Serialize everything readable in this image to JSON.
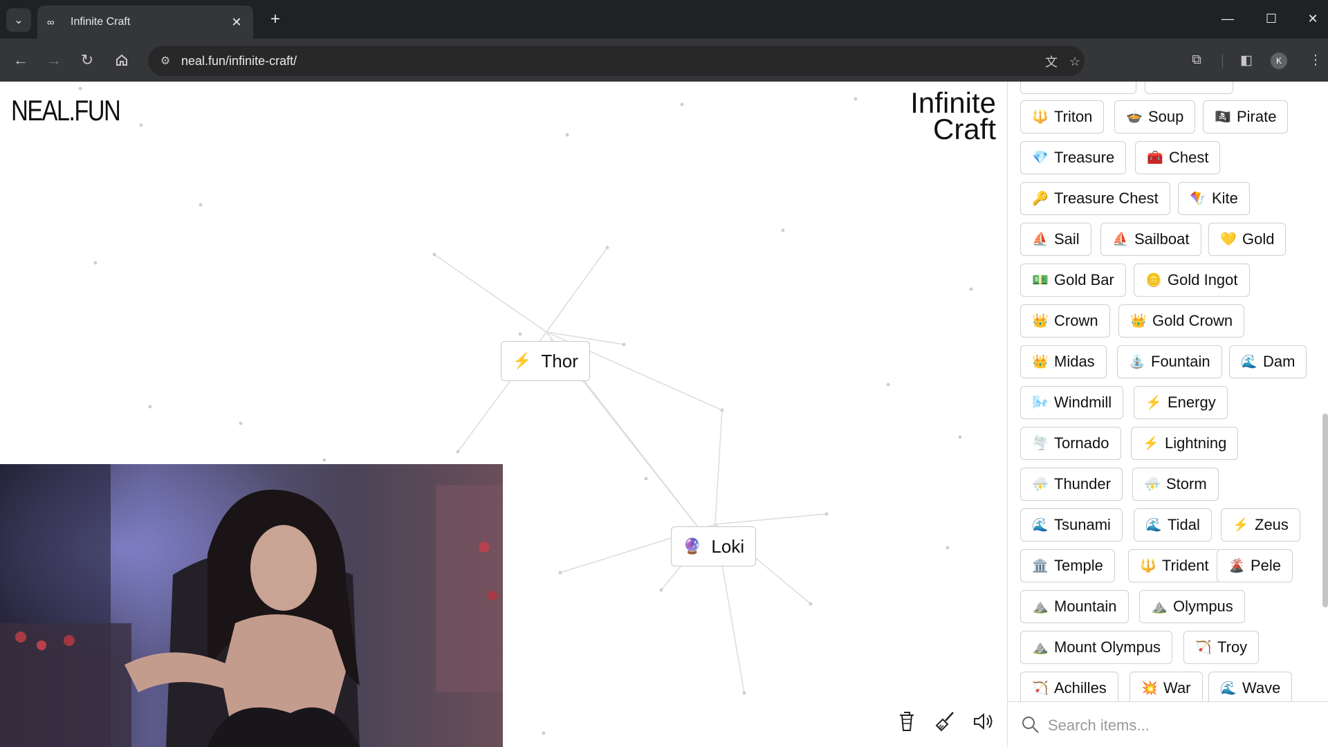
{
  "browser": {
    "tab_title": "Infinite Craft",
    "url": "neal.fun/infinite-craft/",
    "avatar_letter": "K"
  },
  "page": {
    "logo": "NEAL.FUN",
    "title_line1": "Infinite",
    "title_line2": "Craft"
  },
  "canvas_items": [
    {
      "emoji": "⚡",
      "label": "Thor"
    },
    {
      "emoji": "🔮",
      "label": "Loki"
    }
  ],
  "sidebar": {
    "items": [
      {
        "emoji": "🔱",
        "label": "Triton"
      },
      {
        "emoji": "🍲",
        "label": "Soup"
      },
      {
        "emoji": "🏴‍☠️",
        "label": "Pirate"
      },
      {
        "emoji": "💎",
        "label": "Treasure"
      },
      {
        "emoji": "🧰",
        "label": "Chest"
      },
      {
        "emoji": "🔑",
        "label": "Treasure Chest"
      },
      {
        "emoji": "🪁",
        "label": "Kite"
      },
      {
        "emoji": "⛵",
        "label": "Sail"
      },
      {
        "emoji": "⛵",
        "label": "Sailboat"
      },
      {
        "emoji": "💛",
        "label": "Gold"
      },
      {
        "emoji": "💵",
        "label": "Gold Bar"
      },
      {
        "emoji": "🪙",
        "label": "Gold Ingot"
      },
      {
        "emoji": "👑",
        "label": "Crown"
      },
      {
        "emoji": "👑",
        "label": "Gold Crown"
      },
      {
        "emoji": "👑",
        "label": "Midas"
      },
      {
        "emoji": "⛲",
        "label": "Fountain"
      },
      {
        "emoji": "🌊",
        "label": "Dam"
      },
      {
        "emoji": "🌬️",
        "label": "Windmill"
      },
      {
        "emoji": "⚡",
        "label": "Energy"
      },
      {
        "emoji": "🌪️",
        "label": "Tornado"
      },
      {
        "emoji": "⚡",
        "label": "Lightning"
      },
      {
        "emoji": "⛈️",
        "label": "Thunder"
      },
      {
        "emoji": "⛈️",
        "label": "Storm"
      },
      {
        "emoji": "🌊",
        "label": "Tsunami"
      },
      {
        "emoji": "🌊",
        "label": "Tidal"
      },
      {
        "emoji": "⚡",
        "label": "Zeus"
      },
      {
        "emoji": "🏛️",
        "label": "Temple"
      },
      {
        "emoji": "🔱",
        "label": "Trident"
      },
      {
        "emoji": "🌋",
        "label": "Pele"
      },
      {
        "emoji": "⛰️",
        "label": "Mountain"
      },
      {
        "emoji": "⛰️",
        "label": "Olympus"
      },
      {
        "emoji": "⛰️",
        "label": "Mount Olympus"
      },
      {
        "emoji": "🏹",
        "label": "Troy"
      },
      {
        "emoji": "🏹",
        "label": "Achilles"
      },
      {
        "emoji": "💥",
        "label": "War"
      },
      {
        "emoji": "🌊",
        "label": "Wave"
      }
    ],
    "search_placeholder": "Search items..."
  }
}
